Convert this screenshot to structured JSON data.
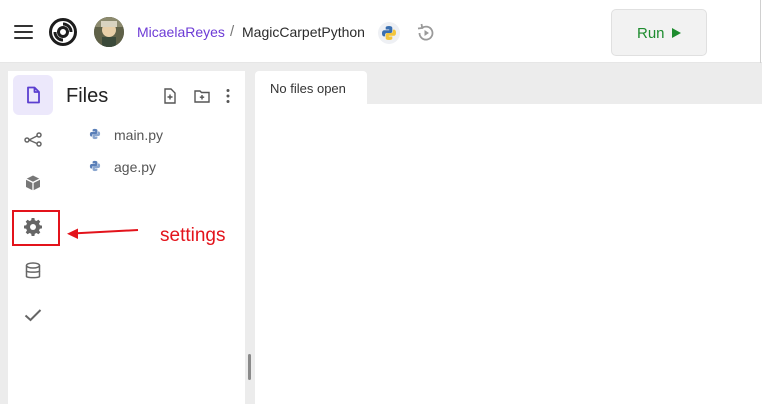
{
  "header": {
    "menu_icon": "hamburger-menu-icon",
    "logo_icon": "replit-logo-icon",
    "avatar_icon": "user-avatar",
    "username": "MicaelaReyes",
    "separator": "/",
    "repl_name": "MagicCarpetPython",
    "language_icon": "python-icon",
    "history_icon": "history-icon",
    "run_label": "Run",
    "run_icon": "play-icon"
  },
  "sidebar": {
    "items": [
      {
        "icon": "file-icon",
        "active": true
      },
      {
        "icon": "share-icon",
        "active": false
      },
      {
        "icon": "packages-cube-icon",
        "active": false
      },
      {
        "icon": "gear-icon",
        "active": false
      },
      {
        "icon": "database-icon",
        "active": false
      },
      {
        "icon": "checkmark-icon",
        "active": false
      }
    ]
  },
  "files_panel": {
    "title": "Files",
    "new_file_icon": "new-file-icon",
    "new_folder_icon": "new-folder-icon",
    "more_icon": "more-vertical-icon",
    "files": [
      {
        "name": "main.py",
        "icon": "python-file-icon"
      },
      {
        "name": "age.py",
        "icon": "python-file-icon"
      }
    ]
  },
  "editor": {
    "tab_label": "No files open"
  },
  "annotation": {
    "label": "settings",
    "color": "#e3131b"
  },
  "colors": {
    "accent": "#6d3bd6",
    "run_green": "#1e8c2f",
    "active_rail": "#ece8fb",
    "python_blue": "#5a7fb8"
  }
}
